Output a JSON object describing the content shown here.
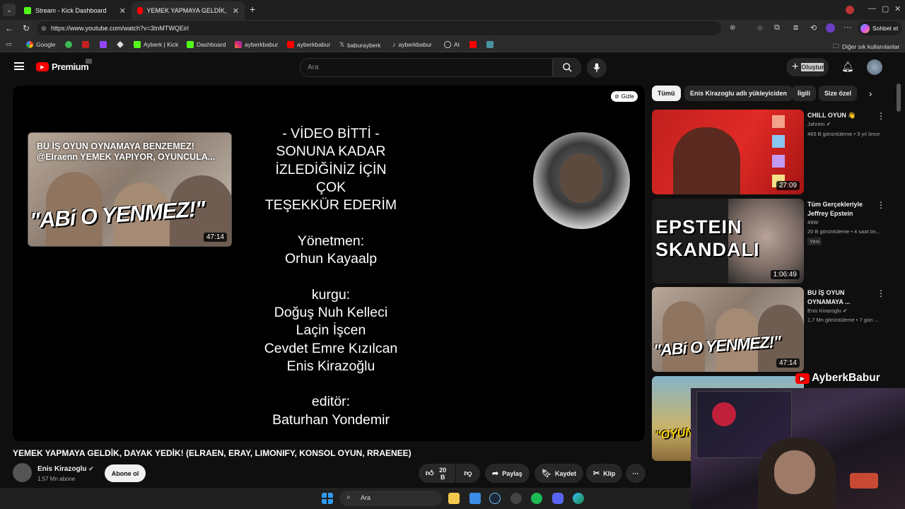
{
  "browser": {
    "tabs": [
      {
        "title": "Stream - Kick Dashboard",
        "icon": "kick-icon"
      },
      {
        "title": "YEMEK YAPMAYA GELDİK, DAYAK Y",
        "icon": "youtube-icon"
      }
    ],
    "new_tab_label": "+",
    "url": "https://www.youtube.com/watch?v=3tnMTWQEirl",
    "copilot_label": "Sohbet et",
    "bookmarks": [
      {
        "label": "Google"
      },
      {
        "label": ""
      },
      {
        "label": ""
      },
      {
        "label": ""
      },
      {
        "label": ""
      },
      {
        "label": "Ayberk | Kick"
      },
      {
        "label": "Dashboard"
      },
      {
        "label": "ayberkbabur"
      },
      {
        "label": "ayberkbabur"
      },
      {
        "label": "baburayberk"
      },
      {
        "label": "ayberkbabur"
      },
      {
        "label": "AI"
      },
      {
        "label": ""
      },
      {
        "label": ""
      }
    ],
    "other_bookmarks": "Diğer sık kullanılanlar"
  },
  "youtube": {
    "logo_text": "Premium",
    "search_placeholder": "Ara",
    "create_label": "Oluştur",
    "player": {
      "hide_label": "Gizle",
      "endcard": {
        "title": "BU İŞ OYUN OYNAMAYA BENZEMEZ! @Elraenn YEMEK YAPIYOR, OYUNCULA...",
        "big_text": "\"ABi O YENMEZ!\"",
        "duration": "47:14"
      },
      "credits": "- VİDEO BİTTİ -\nSONUNA KADAR\nİZLEDİĞİNİZ İÇİN\nÇOK\nTEŞEKKÜR EDERİM\n\nYönetmen:\nOrhun Kayaalp\n\nkurgu:\nDoğuş Nuh Kelleci\nLaçin İşcen\nCevdet Emre Kızılcan\nEnis Kirazoğlu\n\neditör:\nBaturhan Yondemir"
    },
    "video_title": "YEMEK YAPMAYA GELDİK, DAYAK YEDİK! (ELRAEN, ERAY, LIMONIFY, KONSOL OYUN, RRAENEE)",
    "channel": {
      "name": "Enis Kirazoglu",
      "subscribers": "1,57 Mn abone",
      "subscribe_label": "Abone ol"
    },
    "actions": {
      "likes": "20 B",
      "share": "Paylaş",
      "save": "Kaydet",
      "clip": "Klip"
    },
    "chips": [
      "Tümü",
      "Enis Kirazoglu adlı yükleyiciden",
      "İlgili",
      "Size özel"
    ],
    "recommendations": [
      {
        "title": "CHILL OYUN 👋",
        "channel": "Jahrein",
        "meta": "465 B görüntüleme • 3 yıl önce",
        "duration": "27:09",
        "badge": ""
      },
      {
        "title": "Tüm Gerçekleriyle Jeffrey Epstein",
        "channel": "49W",
        "meta": "20 B görüntüleme • 4 saat ön...",
        "duration": "1:06:49",
        "badge": "Yeni",
        "thumb_text": "EPSTEIN SKANDALI"
      },
      {
        "title": "BU İŞ OYUN OYNAMAYA ...",
        "channel": "Enis Kirazoglu",
        "meta": "1,7 Mn görüntüleme • 7 gün ...",
        "duration": "47:14",
        "badge": "",
        "thumb_text": "\"ABi O YENMEZ!\""
      },
      {
        "title": "",
        "channel": "",
        "meta": "",
        "duration": "",
        "badge": "",
        "thumb_text": "\"OYUN OL"
      }
    ]
  },
  "stream_overlay": {
    "watermark": "AyberkBabur"
  },
  "taskbar": {
    "search_label": "Ara"
  }
}
